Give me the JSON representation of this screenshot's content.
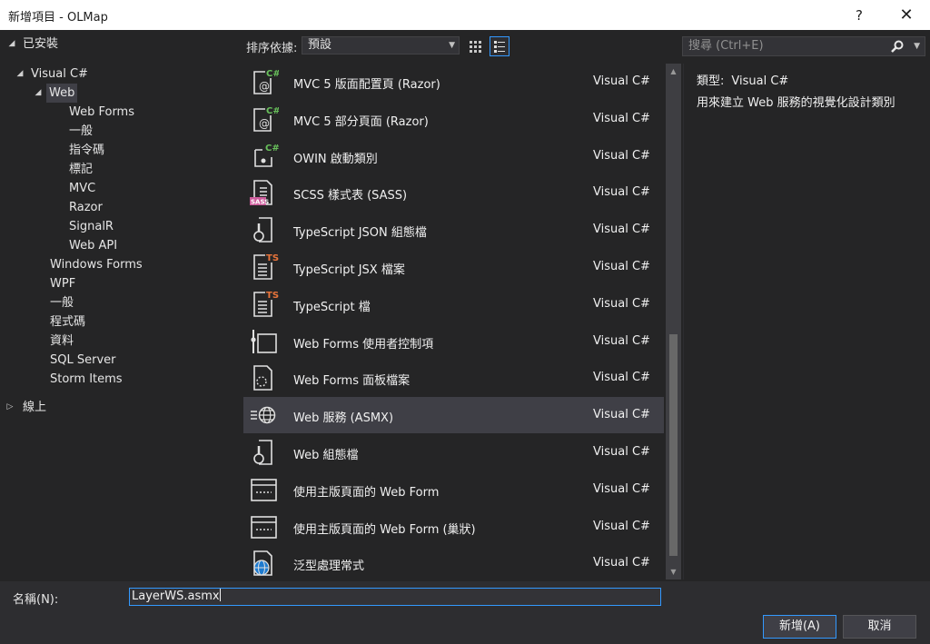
{
  "window": {
    "title": "新增項目 - OLMap",
    "help": "?",
    "close": "✕"
  },
  "tree": {
    "installed": "已安裝",
    "visual_csharp": "Visual C#",
    "web": "Web",
    "web_children": [
      "Web Forms",
      "一般",
      "指令碼",
      "標記",
      "MVC",
      "Razor",
      "SignalR",
      "Web API"
    ],
    "siblings": [
      "Windows Forms",
      "WPF",
      "一般",
      "程式碼",
      "資料",
      "SQL Server",
      "Storm Items"
    ],
    "online": "線上"
  },
  "toolbar": {
    "sort_label": "排序依據:",
    "sort_value": "預設",
    "search_placeholder": "搜尋 (Ctrl+E)"
  },
  "templates": [
    {
      "name": "MVC 5 版面配置頁 (Razor)",
      "lang": "Visual C#",
      "icon": "razor-icon"
    },
    {
      "name": "MVC 5 部分頁面 (Razor)",
      "lang": "Visual C#",
      "icon": "razor-icon"
    },
    {
      "name": "OWIN 啟動類別",
      "lang": "Visual C#",
      "icon": "owin-icon"
    },
    {
      "name": "SCSS 樣式表 (SASS)",
      "lang": "Visual C#",
      "icon": "scss-icon"
    },
    {
      "name": "TypeScript JSON 組態檔",
      "lang": "Visual C#",
      "icon": "config-icon"
    },
    {
      "name": "TypeScript JSX 檔案",
      "lang": "Visual C#",
      "icon": "typescript-icon"
    },
    {
      "name": "TypeScript 檔",
      "lang": "Visual C#",
      "icon": "typescript-icon"
    },
    {
      "name": "Web Forms 使用者控制項",
      "lang": "Visual C#",
      "icon": "user-control-icon"
    },
    {
      "name": "Web Forms 面板檔案",
      "lang": "Visual C#",
      "icon": "skin-file-icon"
    },
    {
      "name": "Web 服務 (ASMX)",
      "lang": "Visual C#",
      "icon": "web-service-icon"
    },
    {
      "name": "Web 組態檔",
      "lang": "Visual C#",
      "icon": "config-icon"
    },
    {
      "name": "使用主版頁面的 Web Form",
      "lang": "Visual C#",
      "icon": "master-page-icon"
    },
    {
      "name": "使用主版頁面的 Web Form (巢狀)",
      "lang": "Visual C#",
      "icon": "master-page-icon"
    },
    {
      "name": "泛型處理常式",
      "lang": "Visual C#",
      "icon": "generic-handler-icon"
    }
  ],
  "selected_index": 9,
  "details": {
    "type_key": "類型:",
    "type_value": "Visual C#",
    "description": "用來建立 Web 服務的視覺化設計類別"
  },
  "bottom": {
    "name_label": "名稱(N):",
    "name_value": "LayerWS.asmx",
    "add_button": "新增(A)",
    "cancel_button": "取消"
  },
  "colors": {
    "accent": "#3399ff",
    "csharp": "#68c05b",
    "typescript": "#e8743b",
    "sass": "#cd5c9c"
  }
}
